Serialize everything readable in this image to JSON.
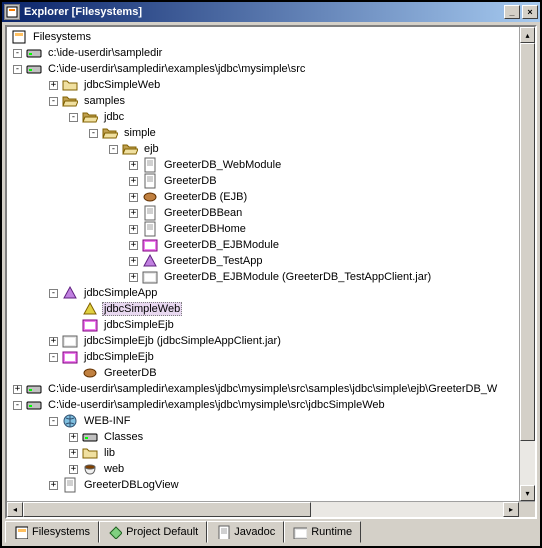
{
  "window": {
    "title": "Explorer [Filesystems]"
  },
  "tree": {
    "root": "Filesystems",
    "n1": "c:\\ide-userdir\\sampledir",
    "n2": "C:\\ide-userdir\\sampledir\\examples\\jdbc\\mysimple\\src",
    "n3": "jdbcSimpleWeb",
    "n4": "samples",
    "n5": "jdbc",
    "n6": "simple",
    "n7": "ejb",
    "n8": "GreeterDB_WebModule",
    "n9": "GreeterDB",
    "n10": "GreeterDB (EJB)",
    "n11": "GreeterDBBean",
    "n12": "GreeterDBHome",
    "n13": "GreeterDB_EJBModule",
    "n14": "GreeterDB_TestApp",
    "n15": "GreeterDB_EJBModule (GreeterDB_TestAppClient.jar)",
    "n16": "jdbcSimpleApp",
    "n17": "jdbcSimpleWeb",
    "n18": "jdbcSimpleEjb",
    "n19": "jdbcSimpleEjb (jdbcSimpleAppClient.jar)",
    "n20": "jdbcSimpleEjb",
    "n21": "GreeterDB",
    "n22": "C:\\ide-userdir\\sampledir\\examples\\jdbc\\mysimple\\src\\samples\\jdbc\\simple\\ejb\\GreeterDB_W",
    "n23": "C:\\ide-userdir\\sampledir\\examples\\jdbc\\mysimple\\src\\jdbcSimpleWeb",
    "n24": "WEB-INF",
    "n25": "Classes",
    "n26": "lib",
    "n27": "web",
    "n28": "GreeterDBLogView"
  },
  "tabs": {
    "t1": "Filesystems",
    "t2": "Project Default",
    "t3": "Javadoc",
    "t4": "Runtime"
  }
}
